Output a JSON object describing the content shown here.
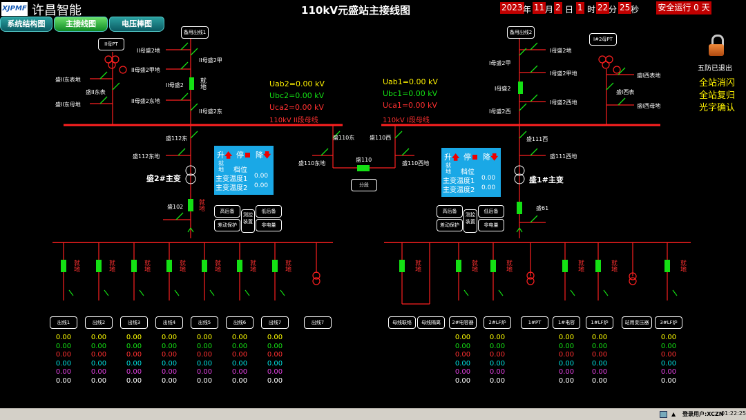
{
  "header": {
    "logo": "XJPMF",
    "company": "许昌智能",
    "title": "110kV元盛站主接线图",
    "date": {
      "year": "2023",
      "year_u": "年",
      "month": "11",
      "month_u": "月",
      "day": "2",
      "day_u": "日",
      "hour": "1",
      "hour_u": "时",
      "minute": "22",
      "minute_u": "分",
      "second": "25",
      "second_u": "秒"
    },
    "safe": "安全运行 0 天"
  },
  "tabs": [
    "系统结构图",
    "主接线图",
    "电压棒图"
  ],
  "left_bus": {
    "uab": "Uab2=0.00  kV",
    "ubc": "Ubc2=0.00  kV",
    "uca": "Uca2=0.00  kV",
    "name": "110kV II段母线"
  },
  "right_bus": {
    "uab": "Uab1=0.00  kV",
    "ubc": "Ubc1=0.00  kV",
    "uca": "Uca1=0.00  kV",
    "name": "110kV I段母线"
  },
  "labels": {
    "l_spare": "备用出线1",
    "l_pt": "II母PT",
    "l_sw1": "II母盛2地",
    "l_sw2": "II母盛2甲",
    "l_sw3": "II母盛2甲地",
    "l_sw4": "II母盛2",
    "l_sw5": "II母盛2东地",
    "l_sw6": "II母盛2东",
    "l_pt1": "盛II东表地",
    "l_pt2": "盛II东表",
    "l_pt3": "盛II东母地",
    "l_112": "盛112东",
    "l_112d": "盛112东地",
    "l_main": "盛2#主变",
    "l_102": "盛102",
    "r_spare": "备用出线2",
    "r_pt": "I#2母PT",
    "r_sw1": "I母盛2地",
    "r_sw2": "I母盛2甲",
    "r_sw3": "I母盛2甲地",
    "r_sw4": "I母盛2",
    "r_sw5": "I母盛2西",
    "r_sw6": "I母盛2西地",
    "r_pt1": "盛I西表地",
    "r_pt2": "盛I西表",
    "r_pt3": "盛I西母地",
    "r_111": "盛111西",
    "r_111d": "盛111西地",
    "r_main": "盛1#主变",
    "r_61": "盛61",
    "m_110e": "盛110东",
    "m_110ed": "盛110东地",
    "m_110": "盛110",
    "m_110w": "盛110西",
    "m_110wd": "盛110西地",
    "m_seg": "分段",
    "onsite": "就地"
  },
  "panel": {
    "up": "升",
    "stop": "停",
    "down": "降",
    "mode": "就地",
    "tap": "档位",
    "t1": "主变温度1",
    "t1v": "0.00",
    "t2": "主变温度2",
    "t2v": "0.00"
  },
  "aux_left": [
    "高后备",
    "低后备",
    "差动保护",
    "测控装置",
    "非电量"
  ],
  "aux_right": [
    "高后备",
    "低后备",
    "差动保护",
    "测控装置",
    "非电量"
  ],
  "right_side": {
    "lock": "五防已退出",
    "b1": "全站消闪",
    "b2": "全站复归",
    "b3": "光字确认"
  },
  "feeders_left": [
    "出线1",
    "出线2",
    "出线3",
    "出线4",
    "出线5",
    "出线6",
    "出线7",
    "出线7"
  ],
  "feeders_right": [
    "母线联络",
    "母线隔离",
    "2#电容器",
    "2#LF炉",
    "1#PT",
    "1#电容",
    "1#LF炉",
    "站用变压器",
    "3#LF炉"
  ],
  "meas_values": [
    "0.00",
    "0.00",
    "0.00",
    "0.00",
    "0.00",
    "0.00"
  ],
  "meas_colors": [
    "#ffff00",
    "#14e014",
    "#ff3030",
    "#00e0e0",
    "#e040e0",
    "#ffffff"
  ],
  "status": {
    "user": "登录用户:XCZN",
    "time": "01:22:25"
  }
}
